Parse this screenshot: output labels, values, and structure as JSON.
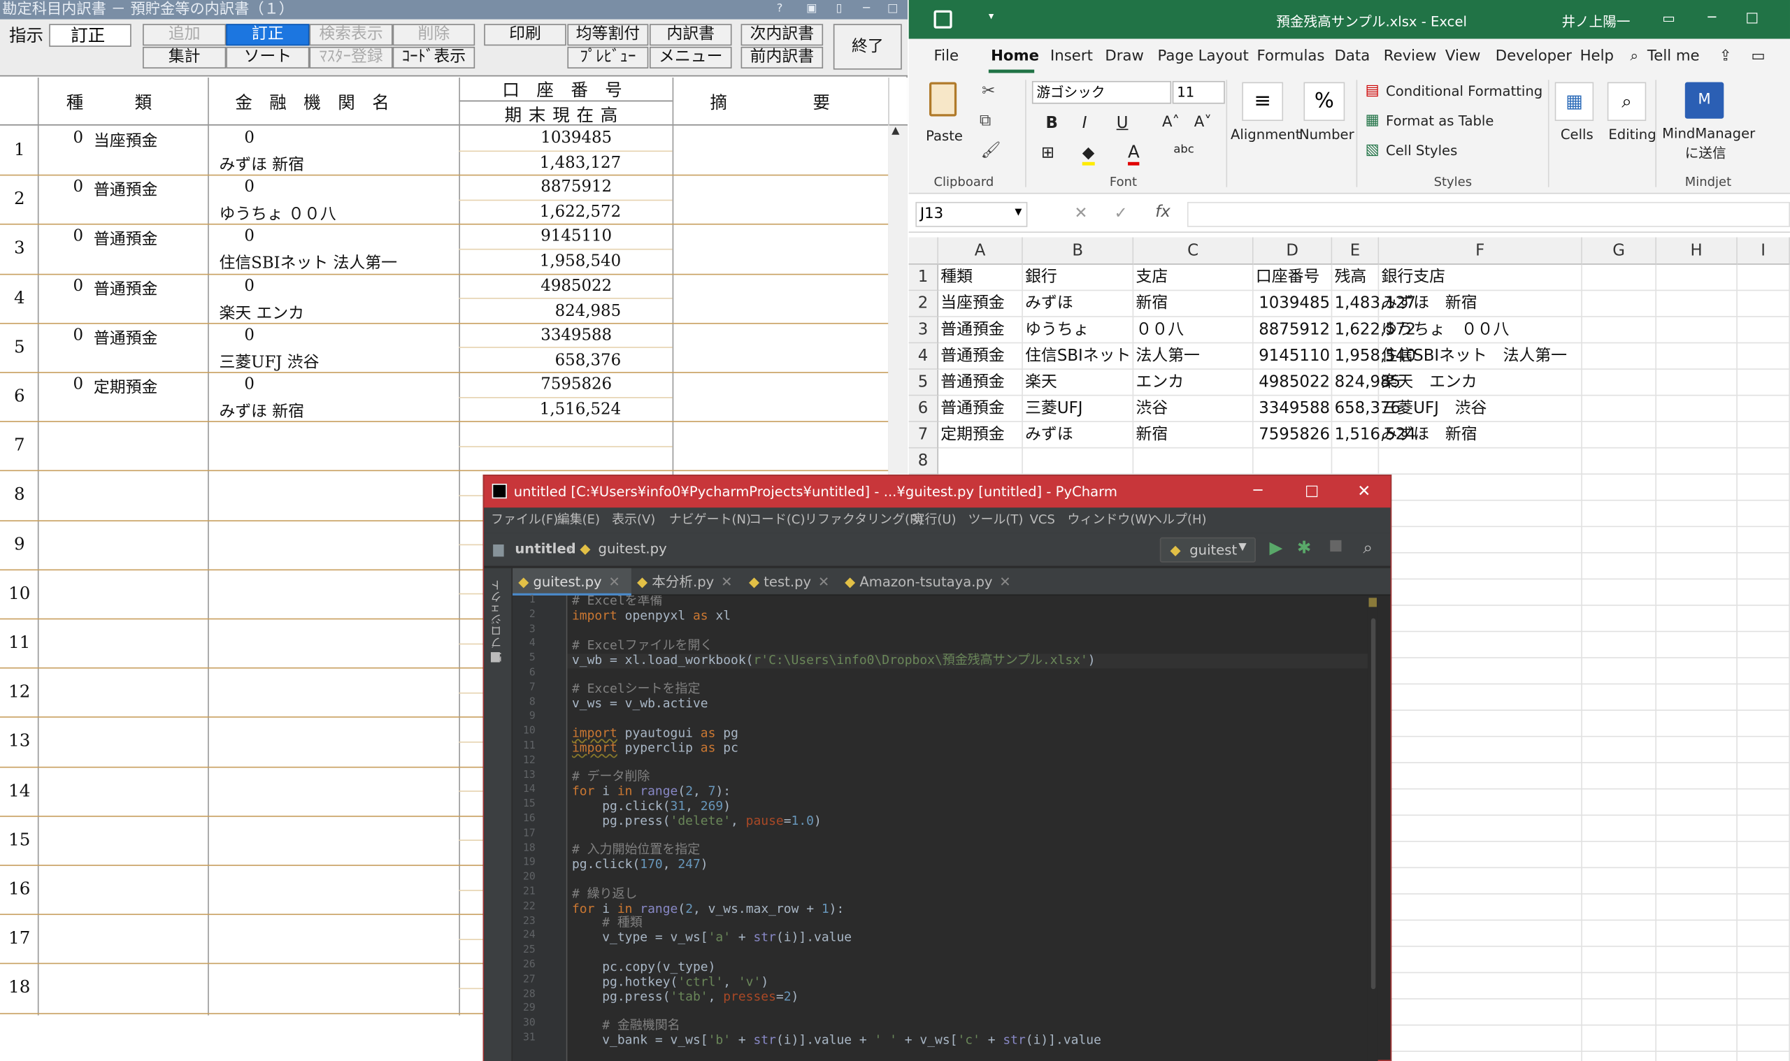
{
  "left_app": {
    "title": "勘定科目内訳書 － 預貯金等の内訳書（１）",
    "shiji_label": "指示",
    "shiji_value": "訂正",
    "buttons_row1": [
      "追加",
      "訂正",
      "検索表示",
      "削除",
      "印刷",
      "均等割付",
      "内訳書",
      "次内訳書"
    ],
    "buttons_row2": [
      "集計",
      "ソート",
      "ﾏｽﾀｰ登録",
      "ｺｰﾄﾞ表示",
      "ﾌﾟﾚﾋﾞｭｰ",
      "メニュー",
      "前内訳書"
    ],
    "exit_label": "終了",
    "headers": {
      "kind": "種　　　類",
      "bank": "金　融　機　関　名",
      "account": "口　座　番　号",
      "balance": "期末現在高",
      "note": "摘　　　　　要"
    },
    "row_numbers": [
      "1",
      "2",
      "3",
      "4",
      "5",
      "6",
      "7",
      "8",
      "9",
      "10",
      "11",
      "12",
      "13",
      "14",
      "15",
      "16",
      "17",
      "18"
    ],
    "rows": [
      {
        "code": "0",
        "kind": "当座預金",
        "bank_code": "0",
        "bank": "みずほ 新宿",
        "account": "1039485",
        "balance": "1,483,127"
      },
      {
        "code": "0",
        "kind": "普通預金",
        "bank_code": "0",
        "bank": "ゆうちょ ００八",
        "account": "8875912",
        "balance": "1,622,572"
      },
      {
        "code": "0",
        "kind": "普通預金",
        "bank_code": "0",
        "bank": "住信SBIネット 法人第一",
        "account": "9145110",
        "balance": "1,958,540"
      },
      {
        "code": "0",
        "kind": "普通預金",
        "bank_code": "0",
        "bank": "楽天 エンカ",
        "account": "4985022",
        "balance": "824,985"
      },
      {
        "code": "0",
        "kind": "普通預金",
        "bank_code": "0",
        "bank": "三菱UFJ 渋谷",
        "account": "3349588",
        "balance": "658,376"
      },
      {
        "code": "0",
        "kind": "定期預金",
        "bank_code": "0",
        "bank": "みずほ 新宿",
        "account": "7595826",
        "balance": "1,516,524"
      }
    ]
  },
  "excel": {
    "title": "預金残高サンプル.xlsx  -  Excel",
    "user": "井ノ上陽一",
    "tabs": [
      "File",
      "Home",
      "Insert",
      "Draw",
      "Page Layout",
      "Formulas",
      "Data",
      "Review",
      "View",
      "Developer",
      "Help",
      "Tell me"
    ],
    "active_tab": "Home",
    "ribbon": {
      "paste": "Paste",
      "clipboard": "Clipboard",
      "font_name": "游ゴシック",
      "font_size": "11",
      "font_group": "Font",
      "alignment": "Alignment",
      "number": "Number",
      "cond_format": "Conditional Formatting",
      "format_table": "Format as Table",
      "cell_styles": "Cell Styles",
      "styles": "Styles",
      "cells": "Cells",
      "editing": "Editing",
      "mindmanager": "MindManager",
      "mindmanager2": "に送信",
      "mindjet": "Mindjet"
    },
    "name_box": "J13",
    "fx": "fx",
    "columns": [
      "A",
      "B",
      "C",
      "D",
      "E",
      "F",
      "G",
      "H",
      "I"
    ],
    "row_numbers": [
      "1",
      "2",
      "3",
      "4",
      "5",
      "6",
      "7",
      "8"
    ],
    "header_row": [
      "種類",
      "銀行",
      "支店",
      "口座番号",
      "残高",
      "銀行支店"
    ],
    "rows": [
      [
        "当座預金",
        "みずほ",
        "新宿",
        "1039485",
        "1,483,127",
        "みずほ　新宿"
      ],
      [
        "普通預金",
        "ゆうちょ",
        "００八",
        "8875912",
        "1,622,572",
        "ゆうちょ　００八"
      ],
      [
        "普通預金",
        "住信SBIネット",
        "法人第一",
        "9145110",
        "1,958,540",
        "住信SBIネット　法人第一"
      ],
      [
        "普通預金",
        "楽天",
        "エンカ",
        "4985022",
        "824,985",
        "楽天　エンカ"
      ],
      [
        "普通預金",
        "三菱UFJ",
        "渋谷",
        "3349588",
        "658,376",
        "三菱UFJ　渋谷"
      ],
      [
        "定期預金",
        "みずほ",
        "新宿",
        "7595826",
        "1,516,524",
        "みずほ　新宿"
      ]
    ]
  },
  "pycharm": {
    "title": "untitled [C:¥Users¥info0¥PycharmProjects¥untitled] - ...¥guitest.py [untitled] - PyCharm",
    "menu": [
      "ファイル(F)",
      "編集(E)",
      "表示(V)",
      "ナビゲート(N)",
      "コード(C)",
      "リファクタリング(R)",
      "実行(U)",
      "ツール(T)",
      "VCS",
      "ウィンドウ(W)",
      "ヘルプ(H)"
    ],
    "breadcrumb_project": "untitled",
    "breadcrumb_file": "guitest.py",
    "run_config": "guitest",
    "side_label": "1: プロジェクト",
    "tabs": [
      "guitest.py",
      "本分析.py",
      "test.py",
      "Amazon-tsutaya.py"
    ],
    "line_numbers": [
      "1",
      "2",
      "3",
      "4",
      "5",
      "6",
      "7",
      "8",
      "9",
      "10",
      "11",
      "12",
      "13",
      "14",
      "15",
      "16",
      "17",
      "18",
      "19",
      "20",
      "21",
      "22",
      "23",
      "24",
      "25",
      "26",
      "27",
      "28",
      "29",
      "30",
      "31"
    ]
  }
}
